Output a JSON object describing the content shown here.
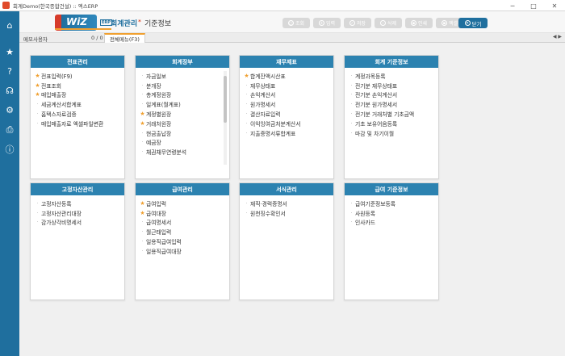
{
  "window": {
    "title": "회계Demo(한국종합건설) :: 엑스ERP",
    "min": "─",
    "max": "□",
    "close": "✕"
  },
  "logo": {
    "text": "WiZ",
    "suffix": "ERP"
  },
  "nav": {
    "main": "회계관리",
    "sub": "기준정보"
  },
  "toolbar": {
    "buttons": [
      {
        "label": "조회",
        "icon": "○"
      },
      {
        "label": "입력",
        "icon": "+"
      },
      {
        "label": "저장",
        "icon": "✓"
      },
      {
        "label": "삭제",
        "icon": "−"
      },
      {
        "label": "인쇄",
        "icon": "▪"
      },
      {
        "label": "엑셀",
        "icon": "▪"
      }
    ],
    "close_label": "닫기",
    "close_icon": "✕"
  },
  "tabbar": {
    "memo": "메모사용자",
    "count": "0 / 0",
    "active_tab": "전체메뉴(F3)",
    "arrows": "◀ ▶"
  },
  "panels": [
    {
      "title": "전표관리",
      "items": [
        {
          "label": "전표입력(F9)",
          "fav": true
        },
        {
          "label": "전표조회",
          "fav": true
        },
        {
          "label": "매입매출장",
          "fav": true
        },
        {
          "label": "세금계산서합계표",
          "fav": false
        },
        {
          "label": "홈택스자료검증",
          "fav": false
        },
        {
          "label": "매입매출자료 엑셀파일변환",
          "fav": false
        }
      ]
    },
    {
      "title": "회계장부",
      "items": [
        {
          "label": "자금일보",
          "fav": false
        },
        {
          "label": "분개장",
          "fav": false
        },
        {
          "label": "총계정원장",
          "fav": false
        },
        {
          "label": "일계표(월계표)",
          "fav": false
        },
        {
          "label": "계정별원장",
          "fav": true
        },
        {
          "label": "거래처원장",
          "fav": true
        },
        {
          "label": "현금출납장",
          "fav": false
        },
        {
          "label": "예금장",
          "fav": false
        },
        {
          "label": "채권채무연령분석",
          "fav": false
        }
      ]
    },
    {
      "title": "재무제표",
      "items": [
        {
          "label": "합계잔액시산표",
          "fav": true
        },
        {
          "label": "재무상태표",
          "fav": false
        },
        {
          "label": "손익계산서",
          "fav": false
        },
        {
          "label": "원가명세서",
          "fav": false
        },
        {
          "label": "결산자료입력",
          "fav": false
        },
        {
          "label": "이익잉여금처분계산서",
          "fav": false
        },
        {
          "label": "지출증명서류합계표",
          "fav": false
        }
      ]
    },
    {
      "title": "회계 기준정보",
      "items": [
        {
          "label": "계정과목등록",
          "fav": false
        },
        {
          "label": "전기분 재무상태표",
          "fav": false
        },
        {
          "label": "전기분 손익계산서",
          "fav": false
        },
        {
          "label": "전기분 원가명세서",
          "fav": false
        },
        {
          "label": "전기분 거래처별 기초금액",
          "fav": false
        },
        {
          "label": "기초 보유어음등록",
          "fav": false
        },
        {
          "label": "마감 및 차기이월",
          "fav": false
        }
      ]
    },
    {
      "title": "고정자산관리",
      "items": [
        {
          "label": "고정자산등록",
          "fav": false
        },
        {
          "label": "고정자산관리대장",
          "fav": false
        },
        {
          "label": "감가상각비명세서",
          "fav": false
        }
      ]
    },
    {
      "title": "급여관리",
      "items": [
        {
          "label": "급여입력",
          "fav": true
        },
        {
          "label": "급여대장",
          "fav": true
        },
        {
          "label": "급여명세서",
          "fav": false
        },
        {
          "label": "월근태입력",
          "fav": false
        },
        {
          "label": "일용직급여입력",
          "fav": false
        },
        {
          "label": "일용직급여대장",
          "fav": false
        }
      ]
    },
    {
      "title": "서식관리",
      "items": [
        {
          "label": "재직·경력증명서",
          "fav": false
        },
        {
          "label": "원천징수확인서",
          "fav": false
        }
      ]
    },
    {
      "title": "급여 기준정보",
      "items": [
        {
          "label": "급여기준정보등록",
          "fav": false
        },
        {
          "label": "사원등록",
          "fav": false
        },
        {
          "label": "인사카드",
          "fav": false
        }
      ]
    }
  ],
  "colors": {
    "accent": "#1f6f9e",
    "panel_header": "#2c82b0",
    "star": "#f0a030"
  }
}
